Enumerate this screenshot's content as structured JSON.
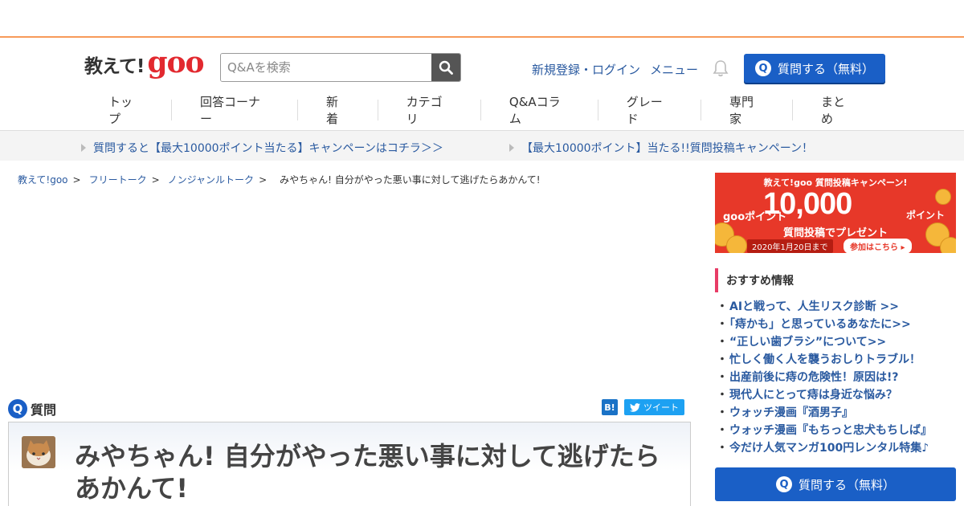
{
  "header": {
    "logo_text": "教えて!",
    "logo_brand": "goo",
    "search_placeholder": "Q&Aを検索",
    "login_link": "新規登録・ログイン",
    "menu_link": "メニュー",
    "ask_button": "質問する（無料）",
    "q_mark": "Q"
  },
  "nav": {
    "items": [
      "トップ",
      "回答コーナー",
      "新着",
      "カテゴリ",
      "Q&Aコラム",
      "グレード",
      "専門家",
      "まとめ"
    ]
  },
  "campaign": {
    "links": [
      "質問すると【最大10000ポイント当たる】キャンペーンはコチラ＞＞",
      "【最大10000ポイント】当たる!!質問投稿キャンペーン！"
    ]
  },
  "breadcrumb": {
    "items": [
      "教えて!goo",
      "フリートーク",
      "ノンジャンルトーク"
    ],
    "separator": ">",
    "current": "みやちゃん! 自分がやった悪い事に対して逃げたらあかんて!"
  },
  "question": {
    "section_label": "質問",
    "title": "みやちゃん! 自分がやった悪い事に対して逃げたらあかんて!",
    "hatena_label": "B!",
    "tweet_label": "ツイート"
  },
  "banner": {
    "top": "教えて!goo 質問投稿キャンペーン!",
    "goo_point": "gooポイント",
    "number": "10,000",
    "point": "ポイント",
    "sub": "質問投稿でプレゼント",
    "date": "2020年1月20日まで",
    "join": "参加はこちら ▸"
  },
  "sidebar": {
    "reco_title": "おすすめ情報",
    "reco_items": [
      "AIと戦って、人生リスク診断 >>",
      "「痔かも」と思っているあなたに>>",
      "“正しい歯ブラシ”について>>",
      "忙しく働く人を襲うおしりトラブル！",
      "出産前後に痔の危険性！原因は!?",
      "現代人にとって痔は身近な悩み？",
      "ウォッチ漫画『酒男子』",
      "ウォッチ漫画『もちっと忠犬もちしば』",
      "今だけ人気マンガ100円レンタル特集♪"
    ],
    "bullet": "・",
    "ask_button": "質問する（無料）"
  },
  "colors": {
    "accent_orange": "#f79a5a",
    "primary_blue": "#1a5fc6",
    "link_blue": "#2a5aa0",
    "banner_red": "#e73829",
    "reco_pink": "#e83c66"
  }
}
